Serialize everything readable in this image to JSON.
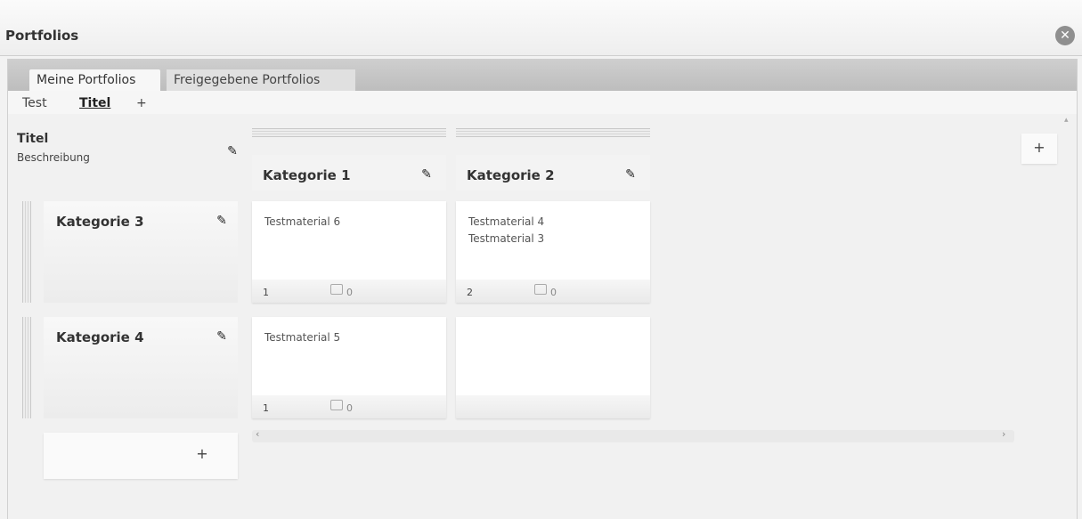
{
  "window": {
    "title": "Portfolios",
    "close_symbol": "✕"
  },
  "tabs": [
    {
      "label": "Meine Portfolios",
      "active": true
    },
    {
      "label": "Freigegebene Portfolios",
      "active": false
    }
  ],
  "subnav": {
    "items": [
      "Test",
      "Titel"
    ],
    "active": "Titel",
    "add_label": "+"
  },
  "portfolio": {
    "title": "Titel",
    "description": "Beschreibung"
  },
  "columns": [
    {
      "title": "Kategorie 1"
    },
    {
      "title": "Kategorie 2"
    }
  ],
  "rows": [
    {
      "title": "Kategorie 3",
      "cells": [
        {
          "items": [
            "Testmaterial 6"
          ],
          "count": "1",
          "comments": "0"
        },
        {
          "items": [
            "Testmaterial 4",
            "Testmaterial 3"
          ],
          "count": "2",
          "comments": "0"
        }
      ]
    },
    {
      "title": "Kategorie 4",
      "cells": [
        {
          "items": [
            "Testmaterial 5"
          ],
          "count": "1",
          "comments": "0"
        },
        {
          "items": [],
          "count": "",
          "comments": ""
        }
      ]
    }
  ],
  "add_row_label": "+",
  "add_column_label": "+",
  "pencil_symbol": "✎",
  "scroll": {
    "left_arrow": "‹",
    "right_arrow": "›",
    "up_arrow": "▴"
  }
}
